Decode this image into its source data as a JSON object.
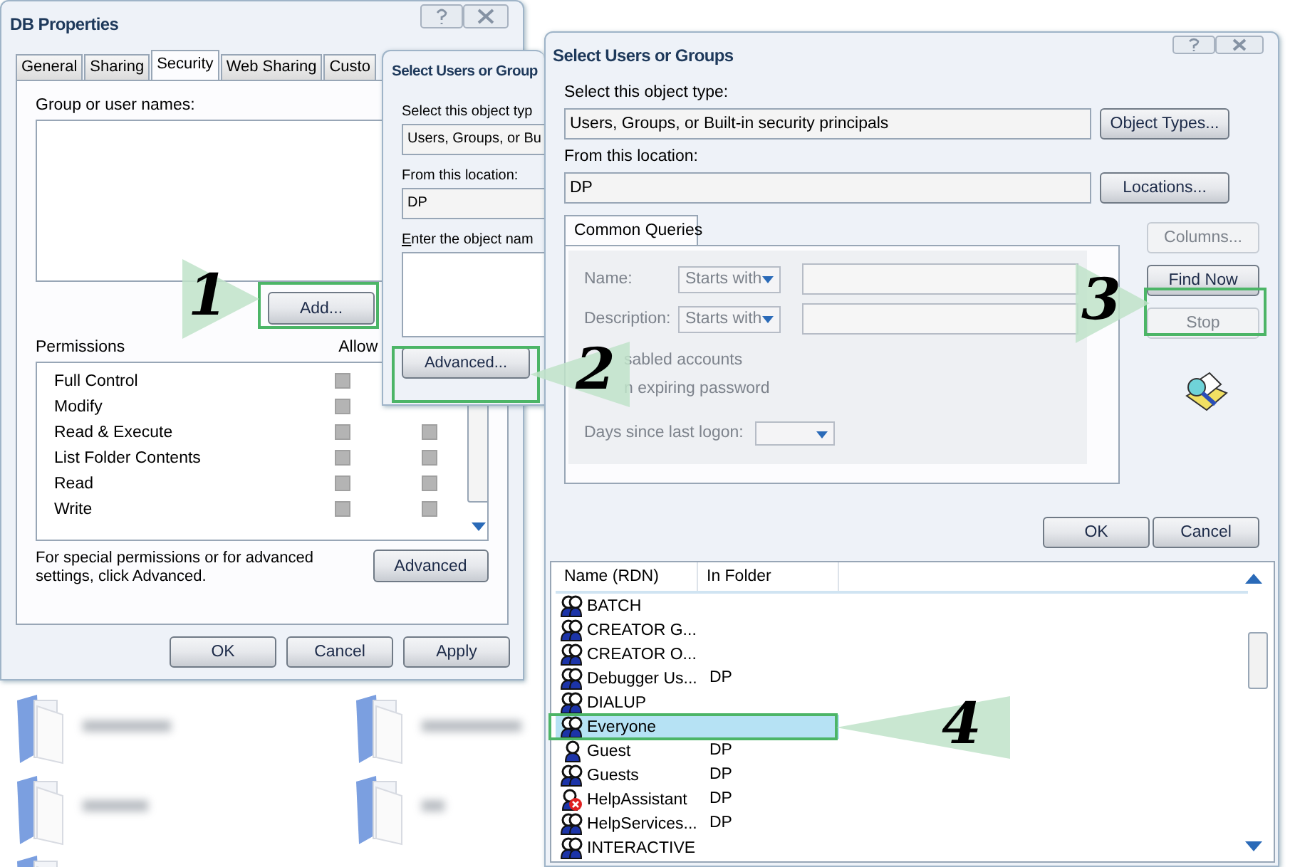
{
  "properties_window": {
    "title": "DB Properties",
    "tabs": [
      {
        "label": "General",
        "selected": false
      },
      {
        "label": "Sharing",
        "selected": false
      },
      {
        "label": "Security",
        "selected": true
      },
      {
        "label": "Web Sharing",
        "selected": false
      },
      {
        "label": "Custo",
        "selected": false
      }
    ],
    "group_label": "Group or user names:",
    "add_button": "Add...",
    "permissions_label": "Permissions",
    "allow_label": "Allow",
    "permissions": [
      {
        "name": "Full Control",
        "allow": false
      },
      {
        "name": "Modify",
        "allow": false
      },
      {
        "name": "Read & Execute",
        "allow": false,
        "deny": false
      },
      {
        "name": "List Folder Contents",
        "allow": false,
        "deny": false
      },
      {
        "name": "Read",
        "allow": false,
        "deny": false
      },
      {
        "name": "Write",
        "allow": false,
        "deny": false
      }
    ],
    "advanced_note": "For special permissions or for advanced settings, click Advanced.",
    "advanced_button": "Advanced",
    "buttons": [
      "OK",
      "Cancel",
      "Apply"
    ]
  },
  "back_dialog": {
    "title": "Select Users or Group",
    "object_type_label": "Select this object typ",
    "object_type": "Users, Groups, or Bu",
    "location_label": "From this location:",
    "location": "DP",
    "names_label": "Enter the object nam",
    "advanced_button": "Advanced..."
  },
  "select_dialog": {
    "title": "Select Users or Groups",
    "object_type_label": "Select this object type:",
    "object_type": "Users, Groups, or Built-in security principals",
    "object_types_button": "Object Types...",
    "location_label": "From this location:",
    "location": "DP",
    "locations_button": "Locations...",
    "query_tab": {
      "label": "Common Queries",
      "selected": true
    },
    "query": {
      "disabled": true,
      "name_label": "Name:",
      "name_mode": "Starts with",
      "description_label": "Description:",
      "description_mode": "Starts with",
      "options": [
        "sabled accounts",
        "n expiring password"
      ],
      "days_label": "Days since last logon:"
    },
    "side_buttons": [
      {
        "label": "Columns...",
        "disabled": true
      },
      {
        "label": "Find Now",
        "disabled": false
      },
      {
        "label": "Stop",
        "disabled": true
      }
    ],
    "buttons": [
      "OK",
      "Cancel"
    ],
    "results": {
      "columns": [
        "Name (RDN)",
        "In Folder"
      ],
      "rows": [
        {
          "name": "BATCH",
          "kind": "group",
          "selected": false
        },
        {
          "name": "CREATOR G...",
          "kind": "group",
          "selected": false
        },
        {
          "name": "CREATOR O...",
          "kind": "group",
          "selected": false
        },
        {
          "name": "Debugger Us...",
          "folder": "DP",
          "kind": "group",
          "selected": false
        },
        {
          "name": "DIALUP",
          "kind": "group",
          "selected": false
        },
        {
          "name": "Everyone",
          "kind": "group",
          "selected": true
        },
        {
          "name": "Guest",
          "folder": "DP",
          "kind": "user",
          "selected": false
        },
        {
          "name": "Guests",
          "folder": "DP",
          "kind": "group",
          "selected": false
        },
        {
          "name": "HelpAssistant",
          "folder": "DP",
          "kind": "disabled_user",
          "selected": false
        },
        {
          "name": "HelpServices...",
          "folder": "DP",
          "kind": "group",
          "selected": false
        },
        {
          "name": "INTERACTIVE",
          "kind": "group",
          "selected": false
        }
      ]
    }
  },
  "callouts": [
    {
      "number": "1"
    },
    {
      "number": "2"
    },
    {
      "number": "3"
    },
    {
      "number": "4"
    }
  ]
}
